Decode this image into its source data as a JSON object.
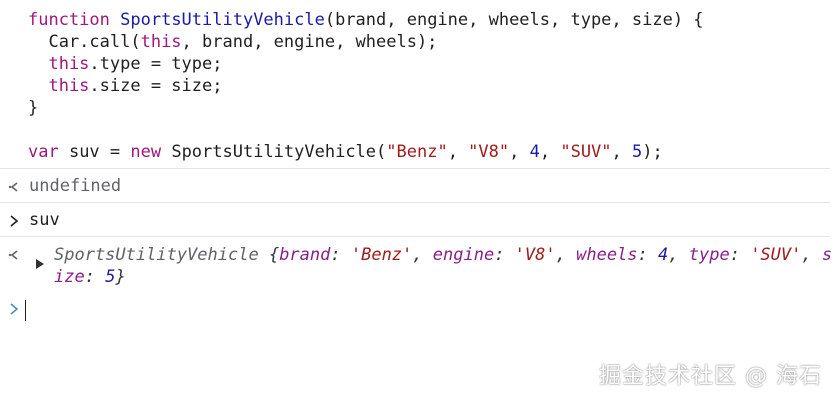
{
  "code": {
    "l1": {
      "kw": "function",
      "name": "SportsUtilityVehicle",
      "rest": "(brand, engine, wheels, type, size) {"
    },
    "l2": {
      "text": "  Car.call(",
      "kw": "this",
      "rest": ", brand, engine, wheels);"
    },
    "l3": {
      "kw": "  this",
      "rest": ".type = type;"
    },
    "l4": {
      "kw": "  this",
      "rest": ".size = size;"
    },
    "l5": {
      "text": "}"
    },
    "l7": {
      "kw_var": "var",
      "mid1": " suv = ",
      "kw_new": "new",
      "mid2": " SportsUtilityVehicle(",
      "s1": "\"Benz\"",
      "c1": ", ",
      "s2": "\"V8\"",
      "c2": ", ",
      "n1": "4",
      "c3": ", ",
      "s3": "\"SUV\"",
      "c4": ", ",
      "n2": "5",
      "end": ");"
    }
  },
  "result1": {
    "text": "undefined"
  },
  "input2": {
    "text": "suv"
  },
  "result2": {
    "class_name": "SportsUtilityVehicle",
    "open": " {",
    "k1": "brand",
    "v1": "'Benz'",
    "k2": "engine",
    "v2": "'V8'",
    "k3": "wheels",
    "v3": "4",
    "k4": "type",
    "v4": "'SUV'",
    "k5a": "s",
    "k5b": "ize",
    "v5": "5",
    "close": "}"
  },
  "watermark": {
    "text": "掘金技术社区 @ 海石"
  },
  "colors": {
    "keyword": "#a0187c",
    "function_name": "#1a1aa6",
    "string": "#a31a1a",
    "number": "#1a1aa6",
    "prompt_blue": "#4a90c2",
    "separator": "#e1e6ea"
  },
  "icons": {
    "result": "return-arrow-icon",
    "input": "prompt-chevron-icon",
    "expand": "expand-triangle-icon"
  }
}
